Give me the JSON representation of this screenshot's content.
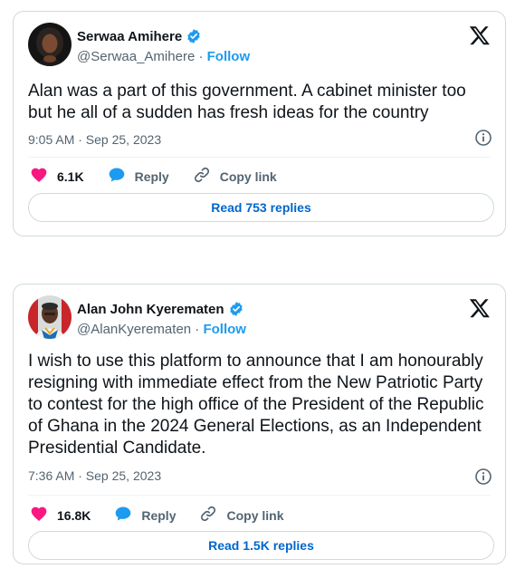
{
  "tweets": [
    {
      "name": "Serwaa Amihere",
      "handle": "@Serwaa_Amihere",
      "separator": "·",
      "follow_label": "Follow",
      "text": "Alan was a part of this government. A cabinet minister too but he all of a sudden has fresh ideas for the country",
      "timestamp": "9:05 AM · Sep 25, 2023",
      "likes": "6.1K",
      "reply_label": "Reply",
      "copy_link_label": "Copy link",
      "read_replies_label": "Read 753 replies"
    },
    {
      "name": "Alan John Kyerematen",
      "handle": "@AlanKyerematen",
      "separator": "·",
      "follow_label": "Follow",
      "text": "I wish to use this platform to announce that I am honourably resigning with immediate effect from the New Patriotic Party to contest for the high office of the President of the Republic of Ghana in the 2024 General Elections, as an Independent Presidential Candidate.",
      "timestamp": "7:36 AM · Sep 25, 2023",
      "likes": "16.8K",
      "reply_label": "Reply",
      "copy_link_label": "Copy link",
      "read_replies_label": "Read 1.5K replies"
    }
  ],
  "icons": {
    "verified": "verified-badge-icon",
    "x_logo": "x-logo-icon",
    "info": "info-icon",
    "heart": "heart-icon",
    "reply": "speech-bubble-icon",
    "copy_link": "link-icon"
  },
  "colors": {
    "accent": "#1d9bf0",
    "like": "#f91880",
    "replies_link": "#0066cc",
    "text": "#0f1419",
    "muted": "#536471",
    "border": "#cfd9de"
  }
}
